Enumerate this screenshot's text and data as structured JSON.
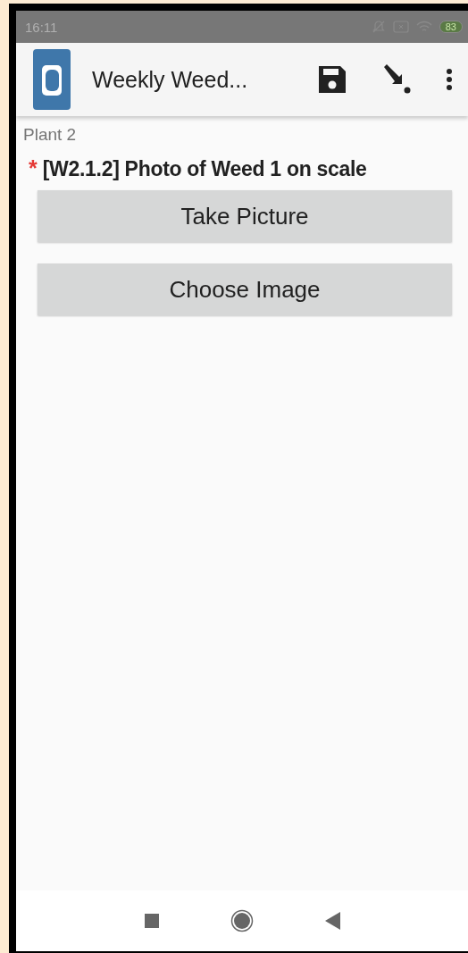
{
  "status_bar": {
    "time": "16:11",
    "battery": "83"
  },
  "app_bar": {
    "title": "Weekly Weed..."
  },
  "form": {
    "group": "Plant 2",
    "required_mark": "*",
    "question": "[W2.1.2] Photo of Weed 1 on scale",
    "buttons": [
      {
        "label": "Take Picture"
      },
      {
        "label": "Choose Image"
      }
    ]
  }
}
